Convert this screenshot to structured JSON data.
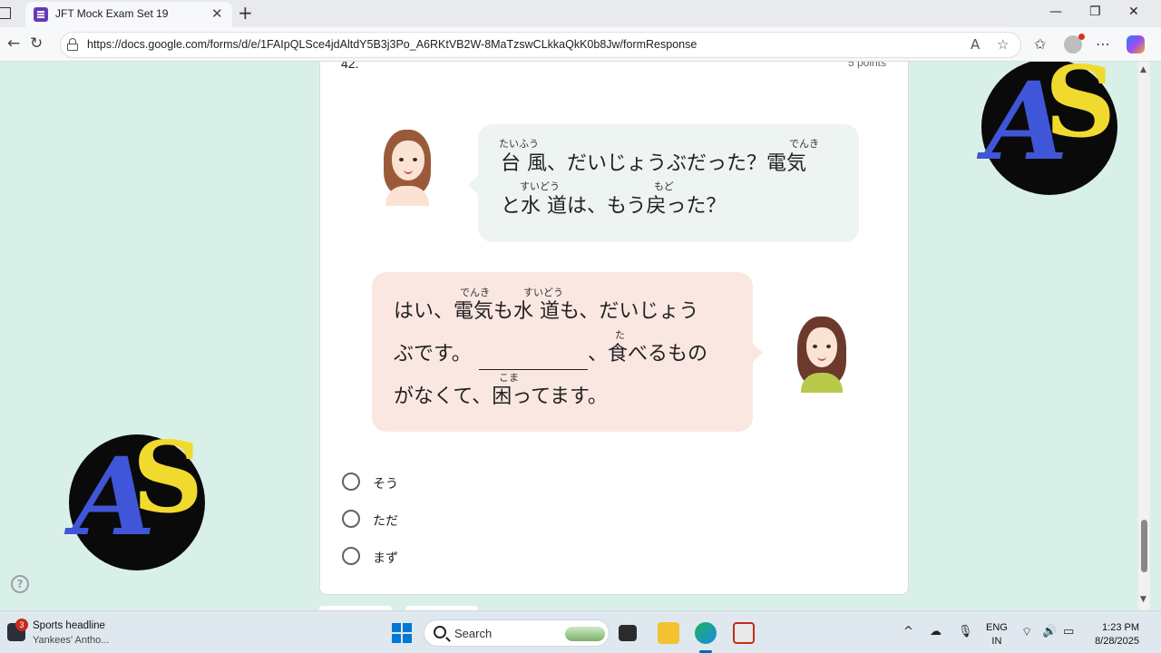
{
  "browser": {
    "tab_title": "JFT Mock Exam Set 19",
    "tab_close": "✕",
    "new_tab": "+",
    "url": "https://docs.google.com/forms/d/e/1FAIpQLSce4jdAltdY5B3j3Po_A6RKtVB2W-8MaTzswCLkkaQkK0b8Jw/formResponse",
    "window_controls": {
      "minimize": "—",
      "restore": "❐",
      "close": "✕"
    },
    "nav": {
      "back": "←",
      "refresh": "↻"
    },
    "toolbar": {
      "read_aloud": "A",
      "favorite": "☆",
      "favorites": "✩",
      "more": "⋯"
    }
  },
  "question": {
    "number": "42.",
    "points": "5 points",
    "bubble_top": {
      "line1": "台 風、だいじょうぶだった？電気",
      "line2": "と水 道は、もう戻った？",
      "ruby": {
        "taifuu": "たいふう",
        "denki": "でんき",
        "suidou": "すいどう",
        "modo": "もど"
      }
    },
    "bubble_bottom": {
      "line1": "はい、電気も水 道も、だいじょう",
      "line2a": "ぶです。",
      "line2b": "、食べるもの",
      "line3": "がなくて、困ってます。",
      "ruby": {
        "denki": "でんき",
        "suidou": "すいどう",
        "ta": "た",
        "koma": "こま"
      }
    },
    "options": [
      "そう",
      "ただ",
      "まず"
    ]
  },
  "help": "?",
  "logos": {
    "letter_a": "A",
    "letter_s": "S"
  },
  "taskbar": {
    "news_badge": "3",
    "news_title": "Sports headline",
    "news_sub": "Yankees' Antho...",
    "search_label": "Search",
    "tray_chevron": "^",
    "lang_line1": "ENG",
    "lang_line2": "IN",
    "time": "1:23 PM",
    "date": "8/28/2025"
  },
  "colors": {
    "page_background": "#d9f0e8",
    "forms_purple": "#673ab7",
    "bubble_top": "#eef4f1",
    "bubble_bottom": "#fbe7e2",
    "logo_blue": "#3f56d8",
    "logo_yellow": "#f1da2e"
  },
  "icons": [
    "forms-icon",
    "lock-icon",
    "read-aloud-icon",
    "star-icon",
    "favorites-icon",
    "profile-icon",
    "more-icon",
    "copilot-icon",
    "radio-icon",
    "help-icon",
    "start-icon",
    "search-icon",
    "wifi-icon",
    "volume-icon",
    "battery-icon",
    "mic-icon"
  ]
}
